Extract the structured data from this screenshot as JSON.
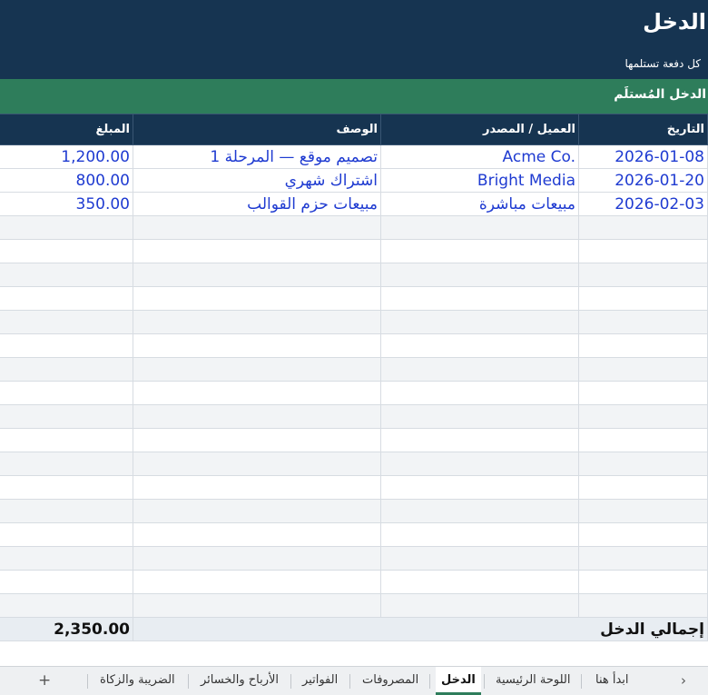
{
  "banner": {
    "title": "الدخل",
    "subtitle": "كل دفعة تستلمها"
  },
  "section": {
    "label": "الدخل المُستلَم"
  },
  "table": {
    "headers": {
      "date": "التاريخ",
      "client": "العميل / المصدر",
      "desc": "الوصف",
      "amount": "المبلغ"
    },
    "rows": [
      {
        "date": "2026-01-08",
        "client": "Acme Co.",
        "desc": "تصميم موقع — المرحلة 1",
        "amount": "1,200.00"
      },
      {
        "date": "2026-01-20",
        "client": "Bright Media",
        "desc": "اشتراك شهري",
        "amount": "800.00"
      },
      {
        "date": "2026-02-03",
        "client": "مبيعات مباشرة",
        "desc": "مبيعات حزم القوالب",
        "amount": "350.00"
      }
    ],
    "total_label": "إجمالي الدخل",
    "total_value": "2,350.00"
  },
  "tabs": [
    "ابدأ هنا",
    "اللوحة الرئيسية",
    "الدخل",
    "المصروفات",
    "الفواتير",
    "الأرباح والخسائر",
    "الضريبة والزكاة"
  ],
  "tabbar": {
    "add_icon": "+",
    "nav_icon": "›"
  }
}
